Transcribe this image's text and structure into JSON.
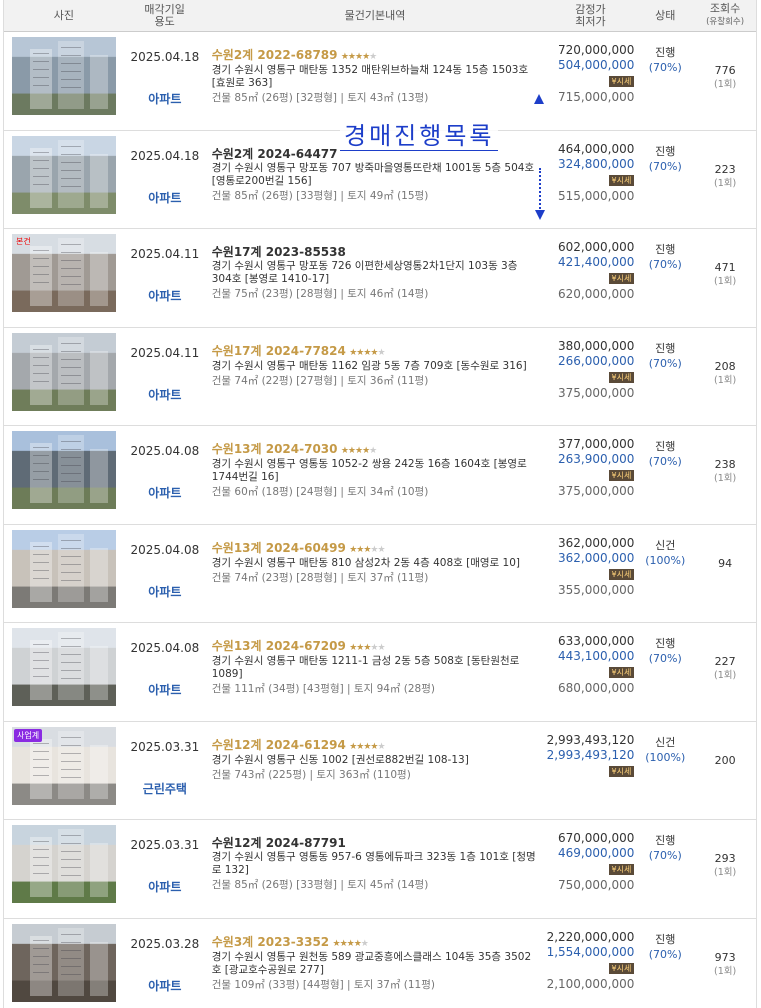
{
  "header": {
    "photo": "사진",
    "date": "매각기일\n용도",
    "date_l1": "매각기일",
    "date_l2": "용도",
    "info": "물건기본내역",
    "price_l1": "감정가",
    "price_l2": "최저가",
    "status": "상태",
    "views_l1": "조회수",
    "views_l2": "(유찰회수)"
  },
  "overlay_title": "경매진행목록",
  "badge_label": "시세",
  "rows": [
    {
      "date": "2025.04.18",
      "type": "아파트",
      "case": "수원2계 2022-68789",
      "gold": true,
      "stars": 4,
      "addr": "경기 수원시 영통구 매탄동 1352 매탄위브하늘채 124동 15층 1503호 [효원로 363]",
      "size": "건물 85㎡ (26평) [32평형]  |  토지 43㎡ (13평)",
      "appraisal": "720,000,000",
      "minimum": "504,000,000",
      "sale": "715,000,000",
      "status": "진행",
      "pct": "(70%)",
      "views": "776",
      "fails": "(1회)",
      "tag": "",
      "colors": [
        "#b7c6d6",
        "#8a9aa8",
        "#6c7a60"
      ]
    },
    {
      "date": "2025.04.18",
      "type": "아파트",
      "case": "수원2계 2024-64477",
      "gold": false,
      "stars": 0,
      "addr": "경기 수원시 영통구 망포동 707 방죽마을영통뜨란채 1001동 5층 504호 [영통로200번길 156]",
      "size": "건물 85㎡ (26평) [33평형]  |  토지 49㎡ (15평)",
      "appraisal": "464,000,000",
      "minimum": "324,800,000",
      "sale": "515,000,000",
      "status": "진행",
      "pct": "(70%)",
      "views": "223",
      "fails": "(1회)",
      "tag": "",
      "colors": [
        "#c9d6e4",
        "#9aa5ad",
        "#7e8c6a"
      ]
    },
    {
      "date": "2025.04.11",
      "type": "아파트",
      "case": "수원17계 2023-85538",
      "gold": false,
      "stars": 0,
      "addr": "경기 수원시 영통구 망포동 726 이편한세상영통2차1단지 103동 3층 304호 [봉영로 1410-17]",
      "size": "건물 75㎡ (23평) [28평형]  |  토지 46㎡ (14평)",
      "appraisal": "602,000,000",
      "minimum": "421,400,000",
      "sale": "620,000,000",
      "status": "진행",
      "pct": "(70%)",
      "views": "471",
      "fails": "(1회)",
      "tag": "본건",
      "colors": [
        "#d7dde3",
        "#a09a94",
        "#7a6a5c"
      ]
    },
    {
      "date": "2025.04.11",
      "type": "아파트",
      "case": "수원17계 2024-77824",
      "gold": true,
      "stars": 4,
      "addr": "경기 수원시 영통구 매탄동 1162 임광 5동 7층 709호 [동수원로 316]",
      "size": "건물 74㎡ (22평) [27평형]  |  토지 36㎡ (11평)",
      "appraisal": "380,000,000",
      "minimum": "266,000,000",
      "sale": "375,000,000",
      "status": "진행",
      "pct": "(70%)",
      "views": "208",
      "fails": "(1회)",
      "tag": "",
      "colors": [
        "#c4ccd4",
        "#a4a8ac",
        "#6f7d5a"
      ]
    },
    {
      "date": "2025.04.08",
      "type": "아파트",
      "case": "수원13계 2024-7030",
      "gold": true,
      "stars": 4,
      "addr": "경기 수원시 영통구 영통동 1052-2 쌍용 242동 16층 1604호 [봉영로 1744번길 16]",
      "size": "건물 60㎡ (18평) [24평형]  |  토지 34㎡ (10평)",
      "appraisal": "377,000,000",
      "minimum": "263,900,000",
      "sale": "375,000,000",
      "status": "진행",
      "pct": "(70%)",
      "views": "238",
      "fails": "(1회)",
      "tag": "",
      "colors": [
        "#a9c0dc",
        "#5f6b76",
        "#6d7c58"
      ]
    },
    {
      "date": "2025.04.08",
      "type": "아파트",
      "case": "수원13계 2024-60499",
      "gold": true,
      "stars": 3,
      "addr": "경기 수원시 영통구 매탄동 810 삼성2차 2동 4층 408호 [매영로 10]",
      "size": "건물 74㎡ (23평) [28평형]  |  토지 37㎡ (11평)",
      "appraisal": "362,000,000",
      "minimum": "362,000,000",
      "sale": "355,000,000",
      "status": "신건",
      "pct": "(100%)",
      "views": "94",
      "fails": "",
      "tag": "",
      "colors": [
        "#b9cde6",
        "#c8c2ba",
        "#7c7a76"
      ]
    },
    {
      "date": "2025.04.08",
      "type": "아파트",
      "case": "수원13계 2024-67209",
      "gold": true,
      "stars": 3,
      "addr": "경기 수원시 영통구 매탄동 1211-1 금성 2동 5층 508호 [동탄원천로 1089]",
      "size": "건물 111㎡ (34평) [43평형]  |  토지 94㎡ (28평)",
      "appraisal": "633,000,000",
      "minimum": "443,100,000",
      "sale": "680,000,000",
      "status": "진행",
      "pct": "(70%)",
      "views": "227",
      "fails": "(1회)",
      "tag": "",
      "colors": [
        "#dfe4ea",
        "#cfd2d4",
        "#5e6058"
      ]
    },
    {
      "date": "2025.03.31",
      "type": "근린주택",
      "case": "수원12계 2024-61294",
      "gold": true,
      "stars": 4,
      "addr": "경기 수원시 영통구 신동 1002 [권선로882번길 108-13]",
      "size": "건물 743㎡ (225평)  |  토지 363㎡ (110평)",
      "appraisal": "2,993,493,120",
      "minimum": "2,993,493,120",
      "sale": "",
      "status": "신건",
      "pct": "(100%)",
      "views": "200",
      "fails": "",
      "tag": "사업계",
      "colors": [
        "#d9dde2",
        "#e8e4de",
        "#8c8a86"
      ]
    },
    {
      "date": "2025.03.31",
      "type": "아파트",
      "case": "수원12계 2024-87791",
      "gold": false,
      "stars": 0,
      "addr": "경기 수원시 영통구 영통동 957-6 영통에듀파크 323동 1층 101호 [청명로 132]",
      "size": "건물 85㎡ (26평) [33평형]  |  토지 45㎡ (14평)",
      "appraisal": "670,000,000",
      "minimum": "469,000,000",
      "sale": "750,000,000",
      "status": "진행",
      "pct": "(70%)",
      "views": "293",
      "fails": "(1회)",
      "tag": "",
      "colors": [
        "#c8d4de",
        "#d5d3cf",
        "#5f7a48"
      ]
    },
    {
      "date": "2025.03.28",
      "type": "아파트",
      "case": "수원3계 2023-3352",
      "gold": true,
      "stars": 4,
      "addr": "경기 수원시 영통구 원천동 589 광교중흥에스클래스 104동 35층 3502호 [광교호수공원로 277]",
      "size": "건물 109㎡ (33평) [44평형]  |  토지 37㎡ (11평)",
      "appraisal": "2,220,000,000",
      "minimum": "1,554,000,000",
      "sale": "2,100,000,000",
      "status": "진행",
      "pct": "(70%)",
      "views": "973",
      "fails": "(1회)",
      "tag": "",
      "colors": [
        "#c6ccd2",
        "#6e655d",
        "#504840"
      ]
    }
  ]
}
